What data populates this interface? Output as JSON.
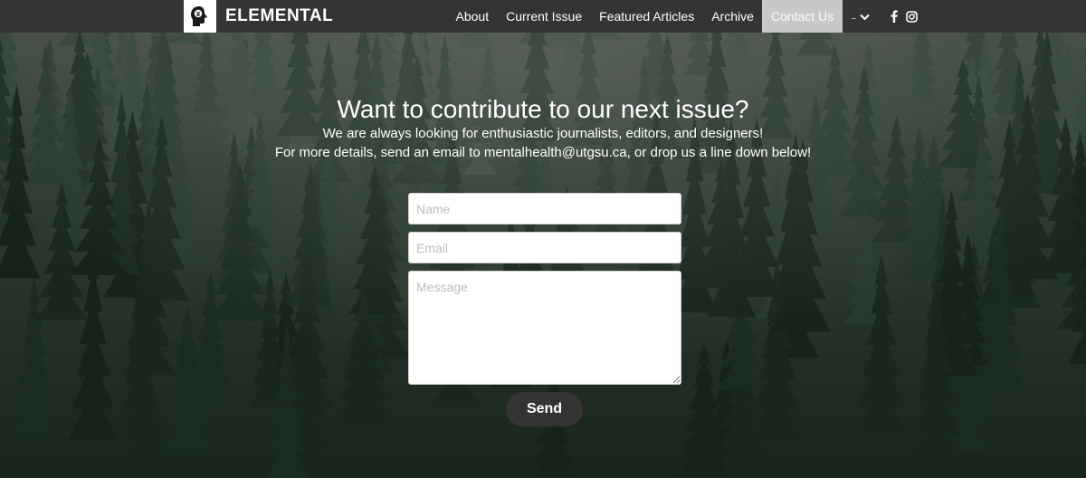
{
  "brand": {
    "name": "ELEMENTAL",
    "logo_icon": "head-brain-icon"
  },
  "nav": {
    "items": [
      "About",
      "Current Issue",
      "Featured Articles",
      "Archive",
      "Contact Us"
    ],
    "active": "Contact Us",
    "more_label": "..."
  },
  "social": [
    "facebook-icon",
    "instagram-icon"
  ],
  "hero": {
    "title": "Want to contribute to our next issue?",
    "line1": "We are always looking for enthusiastic journalists, editors, and designers!",
    "line2": "For more details, send an email to mentalhealth@utgsu.ca, or drop us a line down below!"
  },
  "form": {
    "name_placeholder": "Name",
    "email_placeholder": "Email",
    "message_placeholder": "Message",
    "send_label": "Send"
  },
  "colors": {
    "navbar": "#343434",
    "active_tab": "#c8c8c8",
    "button": "#343434"
  }
}
